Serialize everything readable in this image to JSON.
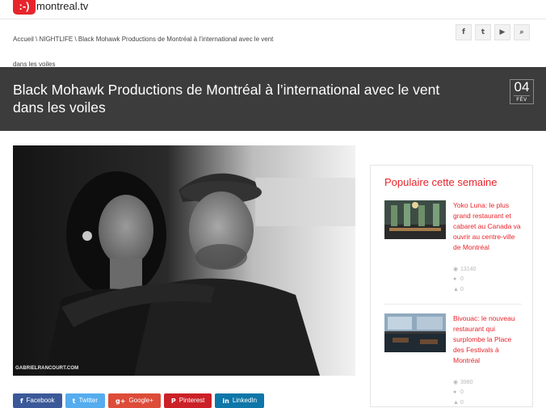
{
  "site": {
    "logo_mark": ":-)",
    "logo_text": "montreal.tv"
  },
  "breadcrumb": "Accueil \\ NIGHTLIFE \\ Black Mohawk Productions de Montréal à l’international avec le vent dans les voiles",
  "social_icons": [
    "facebook-icon",
    "twitter-icon",
    "youtube-icon",
    "search-icon"
  ],
  "social_glyphs": [
    "f",
    "t",
    "▶",
    "⌕"
  ],
  "article": {
    "title": "Black Mohawk Productions de Montréal à l’international avec le vent dans les voiles",
    "date_day": "04",
    "date_month": "FÉV",
    "photo_credit": "GABRIELRANCOURT.COM"
  },
  "share": [
    {
      "label": "Facebook",
      "glyph": "f",
      "color": "#3b5998"
    },
    {
      "label": "Twitter",
      "glyph": "t",
      "color": "#55acee"
    },
    {
      "label": "Google+",
      "glyph": "g+",
      "color": "#dd4b39"
    },
    {
      "label": "Pinterest",
      "glyph": "P",
      "color": "#cb2027"
    },
    {
      "label": "LinkedIn",
      "glyph": "in",
      "color": "#0e76a8"
    }
  ],
  "sidebar": {
    "title": "Populaire cette semaine",
    "posts": [
      {
        "title": "Yoko Luna: le plus grand restaurant et cabaret au Canada va ouvrir au centre-ville de Montréal",
        "views": "13140",
        "comments": "0",
        "likes": "0"
      },
      {
        "title": "Bivouac: le nouveau restaurant qui surplombe la Place des Festivals à Montréal",
        "views": "3980",
        "comments": "0",
        "likes": "0"
      }
    ]
  },
  "colors": {
    "accent": "#e8242b",
    "title_band": "#3c3c3c"
  }
}
